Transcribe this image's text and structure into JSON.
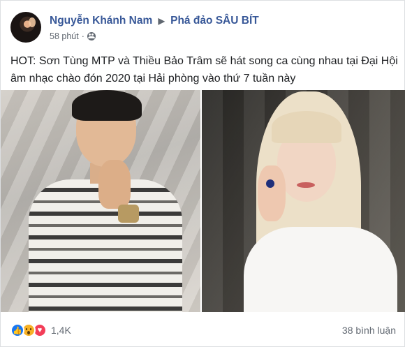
{
  "post": {
    "author": "Nguyễn Khánh Nam",
    "group": "Phá đảo SÂU BÍT",
    "time": "58 phút",
    "separator": "·",
    "text": "HOT: Sơn Tùng MTP và Thiều Bảo Trâm sẽ hát song ca cùng nhau tại Đại Hội âm nhạc chào đón 2020 tại Hải phòng vào thứ 7 tuần này"
  },
  "icons": {
    "audience": "friends-icon",
    "arrow": "right-triangle-icon",
    "more": "more-options-icon"
  },
  "reactions": {
    "types": [
      "like",
      "wow",
      "love"
    ],
    "count": "1,4K"
  },
  "comments": {
    "label": "38 bình luận"
  },
  "colors": {
    "link": "#385898",
    "like": "#1877f2",
    "wow": "#f7b125",
    "love": "#f33e58",
    "meta": "#606770"
  }
}
